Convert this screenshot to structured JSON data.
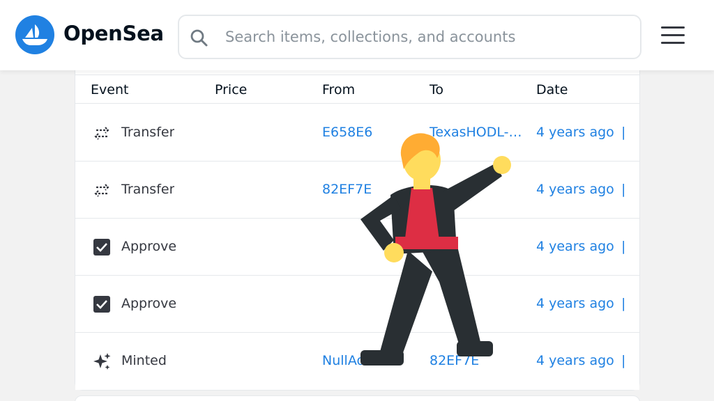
{
  "header": {
    "brand": "OpenSea",
    "logo_icon": "opensea-boat-logo",
    "search": {
      "placeholder": "Search items, collections, and accounts",
      "value": ""
    },
    "menu_icon": "hamburger-menu-icon"
  },
  "activity": {
    "columns": [
      "Event",
      "Price",
      "From",
      "To",
      "Date"
    ],
    "rows": [
      {
        "event": "Transfer",
        "icon": "transfer-arrows-icon",
        "price": "",
        "from": "E658E6",
        "to": "TexasHODL-E...",
        "date": "4 years ago"
      },
      {
        "event": "Transfer",
        "icon": "transfer-arrows-icon",
        "price": "",
        "from": "82EF7E",
        "to": "",
        "date": "4 years ago"
      },
      {
        "event": "Approve",
        "icon": "checkbox-checked-icon",
        "price": "",
        "from": "",
        "to": "",
        "date": "4 years ago"
      },
      {
        "event": "Approve",
        "icon": "checkbox-checked-icon",
        "price": "",
        "from": "",
        "to": "",
        "date": "4 years ago"
      },
      {
        "event": "Minted",
        "icon": "sparkles-icon",
        "price": "",
        "from": "NullAddress",
        "to": "82EF7E",
        "date": "4 years ago"
      }
    ],
    "external_marker": "|"
  },
  "overlay": {
    "emoji": "man-dancing-emoji"
  },
  "colors": {
    "accent": "#2081e2",
    "text": "#353840",
    "border": "#e5e8eb",
    "dancer_red": "#dd2e44",
    "dancer_black": "#292f33",
    "skin": "#ffdc5d",
    "hair": "#ffac33"
  }
}
